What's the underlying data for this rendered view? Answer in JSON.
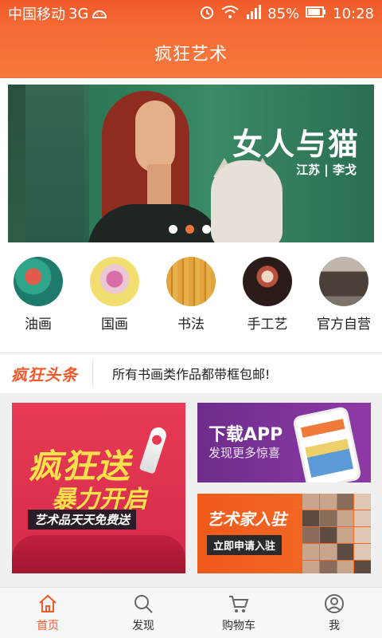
{
  "status_bar": {
    "carrier": "中国移动",
    "network": "3G",
    "battery": "85%",
    "time": "10:28",
    "icons": [
      "alarm-icon",
      "wifi-icon",
      "signal-icon",
      "battery-icon"
    ]
  },
  "header": {
    "title": "疯狂艺术"
  },
  "banner": {
    "title": "女人与猫",
    "subtitle": "江苏 | 李戈",
    "dot_count": 3,
    "active_dot": 1
  },
  "categories": [
    {
      "label": "油画"
    },
    {
      "label": "国画"
    },
    {
      "label": "书法"
    },
    {
      "label": "手工艺"
    },
    {
      "label": "官方自营"
    }
  ],
  "headline": {
    "logo": "疯狂头条",
    "text": "所有书画类作品都带框包邮!"
  },
  "promos": {
    "big": {
      "line1": "疯狂送",
      "line2": "暴力开启",
      "tag": "艺术品天天免费送"
    },
    "app": {
      "title": "下载APP",
      "subtitle": "发现更多惊喜"
    },
    "artist": {
      "title": "艺术家入驻",
      "button": "立即申请入驻"
    }
  },
  "tabbar": [
    {
      "label": "首页",
      "icon": "home-icon",
      "active": true
    },
    {
      "label": "发现",
      "icon": "search-icon",
      "active": false
    },
    {
      "label": "购物车",
      "icon": "cart-icon",
      "active": false
    },
    {
      "label": "我",
      "icon": "user-icon",
      "active": false
    }
  ],
  "colors": {
    "accent": "#f05a2a",
    "status_bg": "#f15a2a"
  }
}
